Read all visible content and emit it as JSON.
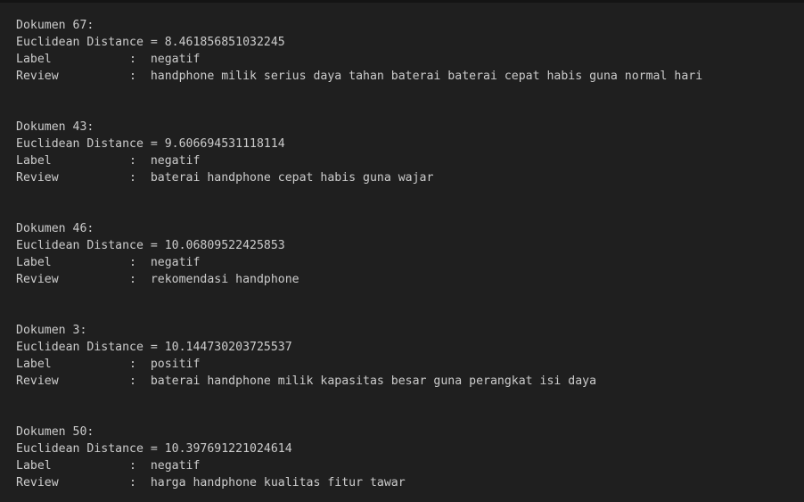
{
  "output": {
    "documents": [
      {
        "header": "Dokumen 67:",
        "distance_line": "Euclidean Distance = 8.461856851032245",
        "label_line": "Label           :  negatif",
        "review_line": "Review          :  handphone milik serius daya tahan baterai baterai cepat habis guna normal hari"
      },
      {
        "header": "Dokumen 43:",
        "distance_line": "Euclidean Distance = 9.606694531118114",
        "label_line": "Label           :  negatif",
        "review_line": "Review          :  baterai handphone cepat habis guna wajar"
      },
      {
        "header": "Dokumen 46:",
        "distance_line": "Euclidean Distance = 10.06809522425853",
        "label_line": "Label           :  negatif",
        "review_line": "Review          :  rekomendasi handphone"
      },
      {
        "header": "Dokumen 3:",
        "distance_line": "Euclidean Distance = 10.144730203725537",
        "label_line": "Label           :  positif",
        "review_line": "Review          :  baterai handphone milik kapasitas besar guna perangkat isi daya"
      },
      {
        "header": "Dokumen 50:",
        "distance_line": "Euclidean Distance = 10.397691221024614",
        "label_line": "Label           :  negatif",
        "review_line": "Review          :  harga handphone kualitas fitur tawar"
      }
    ]
  }
}
